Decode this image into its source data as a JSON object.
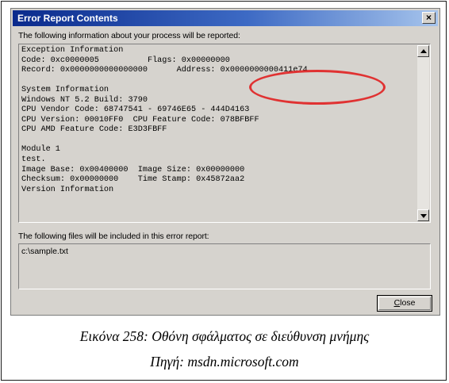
{
  "dialog": {
    "title": "Error Report Contents",
    "close_glyph": "×",
    "report_label": "The following information about your process will be reported:",
    "report_lines": [
      "Exception Information",
      "Code: 0xc0000005          Flags: 0x00000000",
      "Record: 0x0000000000000000      Address: 0x0000000000411e74",
      "",
      "System Information",
      "Windows NT 5.2 Build: 3790",
      "CPU Vendor Code: 68747541 - 69746E65 - 444D4163",
      "CPU Version: 00010FF0  CPU Feature Code: 078BFBFF",
      "CPU AMD Feature Code: E3D3FBFF",
      "",
      "Module 1",
      "test.",
      "Image Base: 0x00400000  Image Size: 0x00000000",
      "Checksum: 0x00000000    Time Stamp: 0x45872aa2",
      "Version Information"
    ],
    "files_label": "The following files will be included in this error report:",
    "files": [
      "c:\\sample.txt"
    ],
    "close_button": {
      "mnemonic": "C",
      "rest": "lose"
    }
  },
  "annotation": {
    "highlight_color": "#e03232"
  },
  "caption": {
    "line1": "Εικόνα 258: Οθόνη σφάλματος σε διεύθυνση μνήμης",
    "line2": "Πηγή: msdn.microsoft.com"
  }
}
